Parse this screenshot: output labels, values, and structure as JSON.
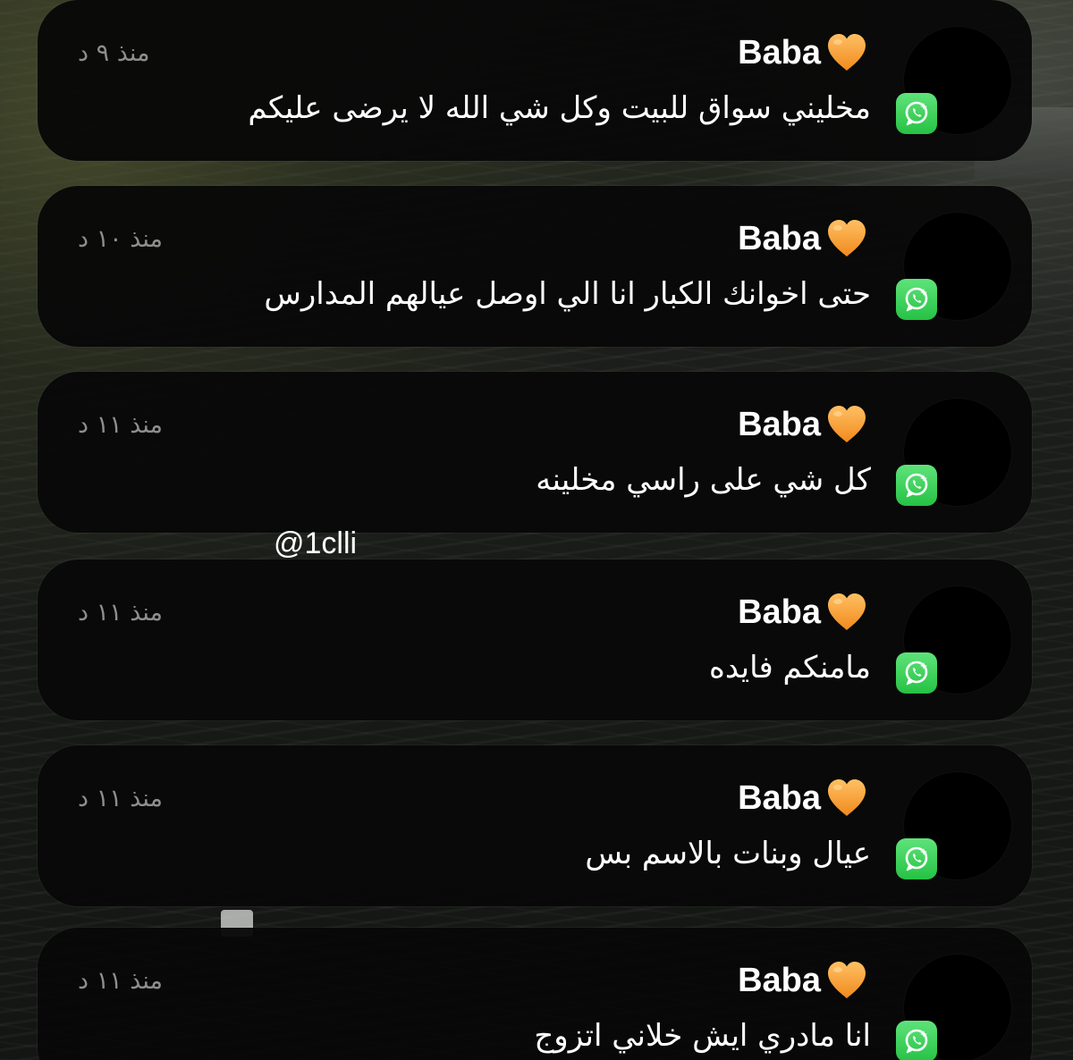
{
  "watermark": "@1clli",
  "notifications": [
    {
      "sender": "Baba",
      "time": "منذ ٩ د",
      "message": "مخليني سواق للبيت وكل شي الله لا يرضى عليكم"
    },
    {
      "sender": "Baba",
      "time": "منذ ١٠ د",
      "message": "حتى اخوانك الكبار انا الي اوصل عيالهم المدارس"
    },
    {
      "sender": "Baba",
      "time": "منذ ١١ د",
      "message": "كل شي على راسي مخلينه"
    },
    {
      "sender": "Baba",
      "time": "منذ ١١ د",
      "message": "مامنكم فايده"
    },
    {
      "sender": "Baba",
      "time": "منذ ١١ د",
      "message": "عيال وبنات بالاسم بس"
    },
    {
      "sender": "Baba",
      "time": "منذ ١١ د",
      "message": "انا مادري ايش خلاني اتزوج"
    }
  ],
  "icons": {
    "app": "whatsapp-icon",
    "emoji": "orange-heart-icon",
    "avatar": "avatar"
  },
  "colors": {
    "card": "#080808",
    "time": "#8e8e8e",
    "heart": "#f7a12f",
    "whatsapp": "#25c244"
  }
}
